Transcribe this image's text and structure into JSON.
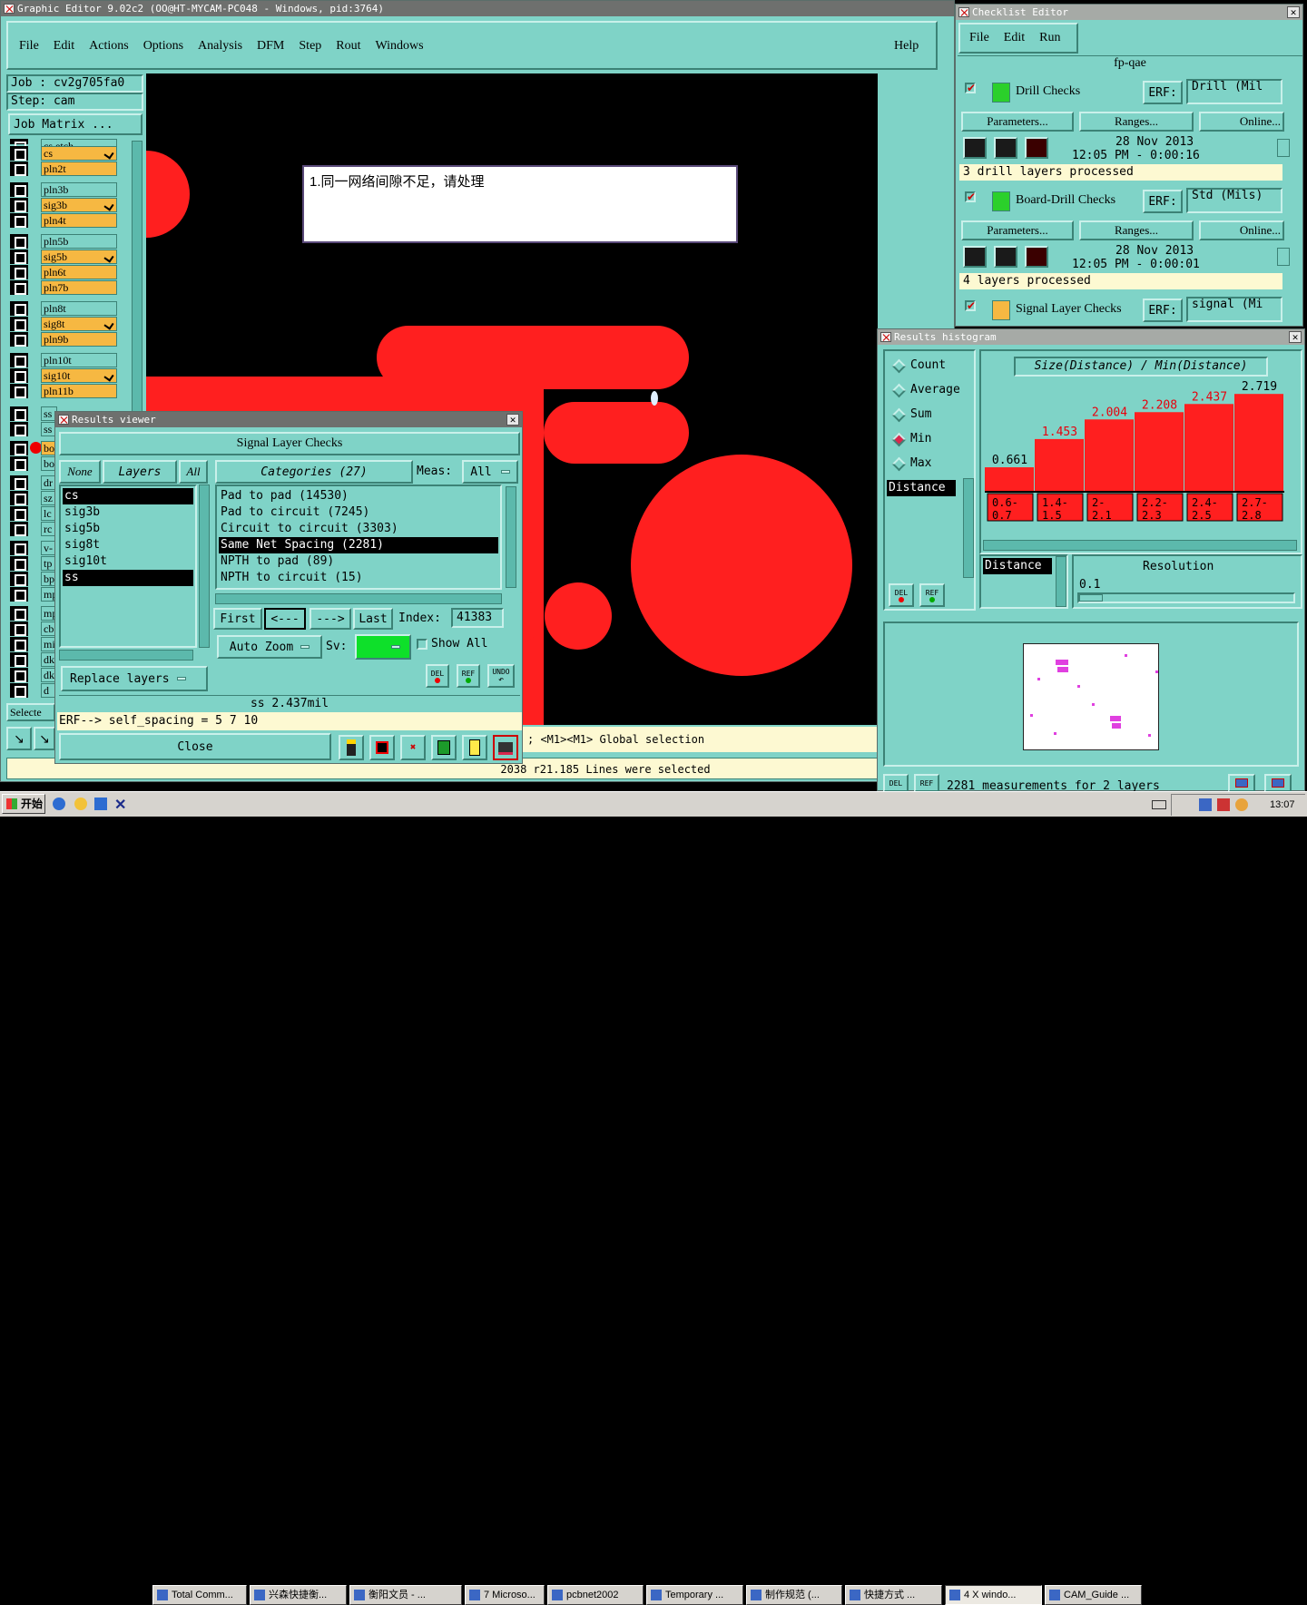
{
  "editor": {
    "title": "Graphic Editor 9.02c2 (OO@HT-MYCAM-PC048 - Windows, pid:3764)",
    "menu": [
      "File",
      "Edit",
      "Actions",
      "Options",
      "Analysis",
      "DFM",
      "Step",
      "Rout",
      "Windows"
    ],
    "help": "Help",
    "job": "Job : cv2g705fa0",
    "step": "Step: cam",
    "job_matrix": "Job Matrix ...",
    "layers": [
      {
        "name": "cs.etch",
        "color": "#7fd3c7",
        "tick": false
      },
      {
        "name": "cs",
        "color": "#f6b842",
        "tick": true
      },
      {
        "name": "pln2t",
        "color": "#f6b842",
        "tick": false
      },
      {
        "name": "pln3b",
        "color": "#7fd3c7",
        "tick": false
      },
      {
        "name": "sig3b",
        "color": "#f6b842",
        "tick": true
      },
      {
        "name": "pln4t",
        "color": "#f6b842",
        "tick": false
      },
      {
        "name": "pln5b",
        "color": "#7fd3c7",
        "tick": false
      },
      {
        "name": "sig5b",
        "color": "#f6b842",
        "tick": true
      },
      {
        "name": "pln6t",
        "color": "#f6b842",
        "tick": false
      },
      {
        "name": "pln7b",
        "color": "#f6b842",
        "tick": false
      },
      {
        "name": "pln8t",
        "color": "#7fd3c7",
        "tick": false
      },
      {
        "name": "sig8t",
        "color": "#f6b842",
        "tick": true
      },
      {
        "name": "pln9b",
        "color": "#f6b842",
        "tick": false
      },
      {
        "name": "pln10t",
        "color": "#7fd3c7",
        "tick": false
      },
      {
        "name": "sig10t",
        "color": "#f6b842",
        "tick": true
      },
      {
        "name": "pln11b",
        "color": "#f6b842",
        "tick": false
      }
    ],
    "hidden_layers": [
      "ss",
      "ss",
      "bo",
      "bo",
      "dr",
      "sz",
      "lc",
      "rc",
      "v-",
      "tp",
      "bp",
      "mp",
      "mp",
      "cb",
      "mi",
      "dk",
      "dk",
      "d"
    ],
    "selected_btn": "Selecte",
    "note": "1.同一网络间隙不足，请处理",
    "status_hint": "; <M1><M1> Global selection",
    "status_bar": "2038 r21.185 Lines were selected"
  },
  "results_viewer": {
    "title": "Results viewer",
    "heading": "Signal Layer Checks",
    "none_btn": "None",
    "layers_btn": "Layers",
    "all_btn": "All",
    "categories_btn": "Categories (27)",
    "meas_label": "Meas:",
    "meas_value": "All",
    "layer_list": [
      {
        "name": "cs",
        "sel": true
      },
      {
        "name": "sig3b",
        "sel": false
      },
      {
        "name": "sig5b",
        "sel": false
      },
      {
        "name": "sig8t",
        "sel": false
      },
      {
        "name": "sig10t",
        "sel": false
      },
      {
        "name": "ss",
        "sel": true
      }
    ],
    "categories": [
      {
        "text": "Pad to pad (14530)",
        "sel": false
      },
      {
        "text": "Pad to circuit (7245)",
        "sel": false
      },
      {
        "text": "Circuit to circuit (3303)",
        "sel": false
      },
      {
        "text": "Same Net Spacing (2281)",
        "sel": true
      },
      {
        "text": "NPTH to pad (89)",
        "sel": false
      },
      {
        "text": "NPTH to circuit (15)",
        "sel": false
      }
    ],
    "first_btn": "First",
    "prev_btn": "<---",
    "next_btn": "--->",
    "last_btn": "Last",
    "index_label": "Index:",
    "index_value": "41383",
    "auto_zoom": "Auto Zoom",
    "sv_label": "Sv:",
    "show_all": "Show All",
    "del": "DEL",
    "ref": "REF",
    "undo": "UNDO",
    "replace_layers": "Replace layers",
    "measurement": "ss 2.437mil",
    "erf_line": "ERF--> self_spacing = 5 7 10",
    "close_btn": "Close"
  },
  "checklist": {
    "title": "Checklist Editor",
    "menu": [
      "File",
      "Edit",
      "Run"
    ],
    "name": "fp-qae",
    "checks": [
      {
        "name": "Drill Checks",
        "erf": "Drill (Mil",
        "date": "28 Nov 2013",
        "time": "12:05 PM - 0:00:16",
        "status": "3 drill layers processed"
      },
      {
        "name": "Board-Drill Checks",
        "erf": "Std (Mils)",
        "date": "28 Nov 2013",
        "time": "12:05 PM - 0:00:01",
        "status": "4 layers processed"
      },
      {
        "name": "Signal Layer Checks",
        "erf": "signal (Mi",
        "date": "",
        "time": "",
        "status": ""
      }
    ],
    "erf_label": "ERF:",
    "params_btn": "Parameters...",
    "ranges_btn": "Ranges...",
    "online_btn": "Online..."
  },
  "histogram": {
    "title": "Results histogram",
    "modes": [
      {
        "label": "Count",
        "on": false
      },
      {
        "label": "Average",
        "on": false
      },
      {
        "label": "Sum",
        "on": false
      },
      {
        "label": "Min",
        "on": true
      },
      {
        "label": "Max",
        "on": false
      }
    ],
    "axis_list_item": "Distance",
    "chart_title": "Size(Distance) / Min(Distance)",
    "del": "DEL",
    "ref": "REF",
    "bins_label": "Distance",
    "resolution_label": "Resolution",
    "resolution_value": "0.1",
    "summary": "2281 measurements for 2 layers"
  },
  "chart_data": {
    "type": "bar",
    "title": "Size(Distance) / Min(Distance)",
    "categories": [
      "0.6-0.7",
      "1.4-1.5",
      "2-2.1",
      "2.2-2.3",
      "2.4-2.5",
      "2.7-2.8"
    ],
    "values": [
      0.661,
      1.453,
      2.004,
      2.208,
      2.437,
      2.719
    ],
    "value_labels": [
      "0.661",
      "1.453",
      "2.004",
      "2.208",
      "2.437",
      "2.719"
    ],
    "bin_labels": [
      [
        "0.6-",
        "0.7"
      ],
      [
        "1.4-",
        "1.5"
      ],
      [
        "2-",
        "2.1"
      ],
      [
        "2.2-",
        "2.3"
      ],
      [
        "2.4-",
        "2.5"
      ],
      [
        "2.7-",
        "2.8"
      ]
    ],
    "label_colors": [
      "#000000",
      "#e8000c",
      "#e8000c",
      "#e8000c",
      "#e8000c",
      "#000000"
    ],
    "ylim": [
      0,
      2.8
    ]
  },
  "taskbar": {
    "start": "开始",
    "items": [
      "Total Comm...",
      "兴森快捷衡...",
      "衡阳文员 - ...",
      "7 Microso...",
      "pcbnet2002",
      "Temporary ...",
      "制作规范 (...",
      "快捷方式 ...",
      "4 X windo...",
      "CAM_Guide ..."
    ],
    "clock": "13:07"
  },
  "colors": {
    "panel": "#7fd3c7",
    "copper": "#ff1f1f",
    "highlight": "#f6b842",
    "shadow": "#3c8276"
  }
}
